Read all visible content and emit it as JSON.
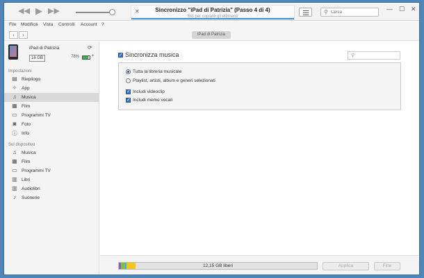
{
  "titlebar": {
    "sync_title": "Sincronizzo \"iPad di Patrizia\" (Passo 4 di 4)",
    "sync_subtitle": "Sto per copiare gli elementi",
    "search_placeholder": "Cerca",
    "volume_level": 0.9,
    "sync_progress": 1.0,
    "icons": {
      "prev": "rewind-icon",
      "play": "play-icon",
      "next": "fast-forward-icon",
      "close": "close-icon",
      "list": "list-view-icon",
      "search": "search-icon"
    }
  },
  "menu": [
    "File",
    "Modifica",
    "Vista",
    "Controlli",
    "Account",
    "?"
  ],
  "nav": {
    "device_button": "iPad di Patrizia"
  },
  "device": {
    "name": "iPad di Patrizia",
    "capacity": "16 GB",
    "battery": "78%",
    "battery_level": 0.78
  },
  "sidebar": {
    "settings_header": "Impostazioni",
    "settings_items": [
      {
        "label": "Riepilogo",
        "icon": "summary-icon",
        "glyph": "▤"
      },
      {
        "label": "App",
        "icon": "apps-icon",
        "glyph": "✧"
      },
      {
        "label": "Musica",
        "icon": "music-icon",
        "glyph": "♫"
      },
      {
        "label": "Film",
        "icon": "film-icon",
        "glyph": "▦"
      },
      {
        "label": "Programmi TV",
        "icon": "tv-icon",
        "glyph": "▭"
      },
      {
        "label": "Foto",
        "icon": "camera-icon",
        "glyph": "◙"
      },
      {
        "label": "Info",
        "icon": "info-icon",
        "glyph": "ⓘ"
      }
    ],
    "selected": "Musica",
    "device_header": "Sul dispositivo",
    "device_items": [
      {
        "label": "Musica",
        "icon": "music-icon",
        "glyph": "♫"
      },
      {
        "label": "Film",
        "icon": "film-icon",
        "glyph": "▦"
      },
      {
        "label": "Programmi TV",
        "icon": "tv-icon",
        "glyph": "▭"
      },
      {
        "label": "Libri",
        "icon": "book-icon",
        "glyph": "▥"
      },
      {
        "label": "Audiolibri",
        "icon": "audiobook-icon",
        "glyph": "▥"
      },
      {
        "label": "Suonerie",
        "icon": "bell-icon",
        "glyph": "♪"
      }
    ]
  },
  "content": {
    "sync_music_label": "Sincronizza musica",
    "sync_music_checked": true,
    "options": {
      "entire_library": "Tutta la libreria musicale",
      "selected_items": "Playlist, artisti, album e generi selezionati",
      "include_videos": "Includi videoclip",
      "include_voice_memos": "Includi memo vocali"
    },
    "selected_option": "entire_library"
  },
  "footer": {
    "free_space": "12,15 GB liberi",
    "apply": "Applica",
    "done": "Fine",
    "usage": [
      {
        "type": "segment-1",
        "fraction": 0.01,
        "color": "#9b59b6"
      },
      {
        "type": "segment-2",
        "fraction": 0.02,
        "color": "#7cc242"
      },
      {
        "type": "segment-3",
        "fraction": 0.01,
        "color": "#3fa9f5"
      },
      {
        "type": "segment-4",
        "fraction": 0.045,
        "color": "#f5c518"
      }
    ]
  },
  "colors": {
    "accent": "#3d8fdc",
    "battery": "#3cb043",
    "desktop": "#4f86b7"
  }
}
